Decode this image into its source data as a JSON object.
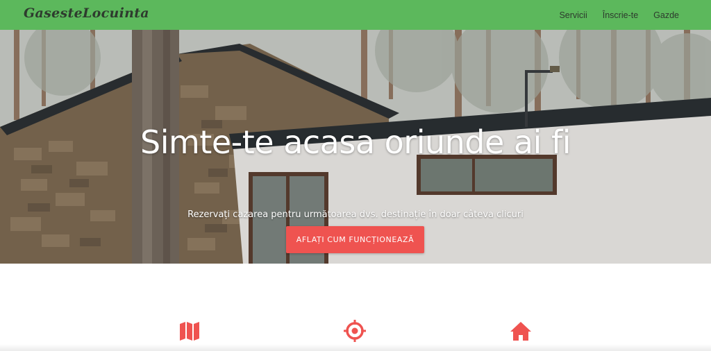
{
  "navbar": {
    "brand": "GasesteLocuinta",
    "links": [
      {
        "label": "Servicii"
      },
      {
        "label": "Înscrie-te"
      },
      {
        "label": "Gazde"
      }
    ]
  },
  "hero": {
    "title": "Simte-te acasa oriunde ai fi",
    "subtitle": "Rezervați cazarea pentru următoarea dvs. destinație în doar câteva clicuri",
    "cta_label": "AFLAȚI CUM FUNCȚIONEAZĂ"
  },
  "features": {
    "icons": [
      "map-icon",
      "crosshairs-icon",
      "home-icon"
    ]
  },
  "colors": {
    "navbar": "#5cb85c",
    "accent": "#ef5350",
    "hero_text": "#ffffff"
  }
}
